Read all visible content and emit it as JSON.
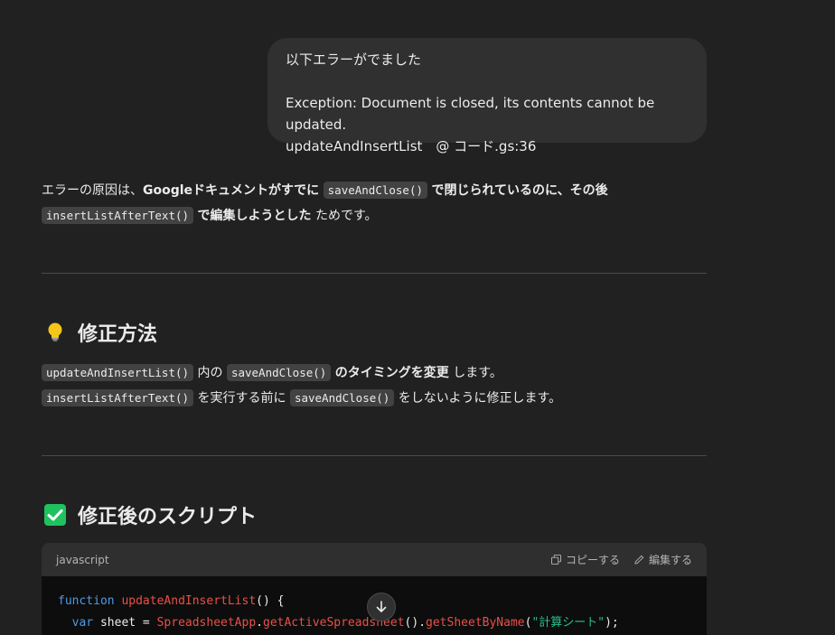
{
  "user_message": {
    "line1": "以下エラーがでました",
    "line2": "Exception: Document is closed, its contents cannot be updated.",
    "line3": "updateAndInsertList　@ コード.gs:36"
  },
  "assistant": {
    "intro": {
      "p1": "エラーの原因は、",
      "p2": "Googleドキュメントがすでに",
      "code1": "saveAndClose()",
      "p3": "で閉じられているのに、その後",
      "code2": "insertListAfterText()",
      "p4": "で編集しようとした",
      "p5": "ためです。"
    },
    "section1": {
      "title": "修正方法",
      "icon": "lightbulb-icon",
      "l1_code1": "updateAndInsertList()",
      "l1_t1": "内の",
      "l1_code2": "saveAndClose()",
      "l1_t2": "のタイミングを変更",
      "l1_t3": "します。",
      "l2_code1": "insertListAfterText()",
      "l2_t1": "を実行する前に",
      "l2_code2": "saveAndClose()",
      "l2_t2": "をしないように修正します。"
    },
    "section2": {
      "title": "修正後のスクリプト",
      "icon": "check-box-icon"
    },
    "codeblock": {
      "language": "javascript",
      "copy_label": "コピーする",
      "edit_label": "編集する",
      "line1_kw": "function",
      "line1_fn": "updateAndInsertList",
      "line1_rest": "() {",
      "line2_kw": "var",
      "line2_var": " sheet = ",
      "line2_obj": "SpreadsheetApp",
      "line2_m1": "getActiveSpreadsheet",
      "line2_m2": "getSheetByName",
      "line2_str": "\"計算シート\""
    }
  },
  "colors": {
    "background": "#212121",
    "bubble": "#303030",
    "keyword": "#4d9ce6",
    "function": "#e8504a",
    "string": "#27c08a",
    "check": "#1fc25e",
    "bulb": "#f5c518"
  }
}
